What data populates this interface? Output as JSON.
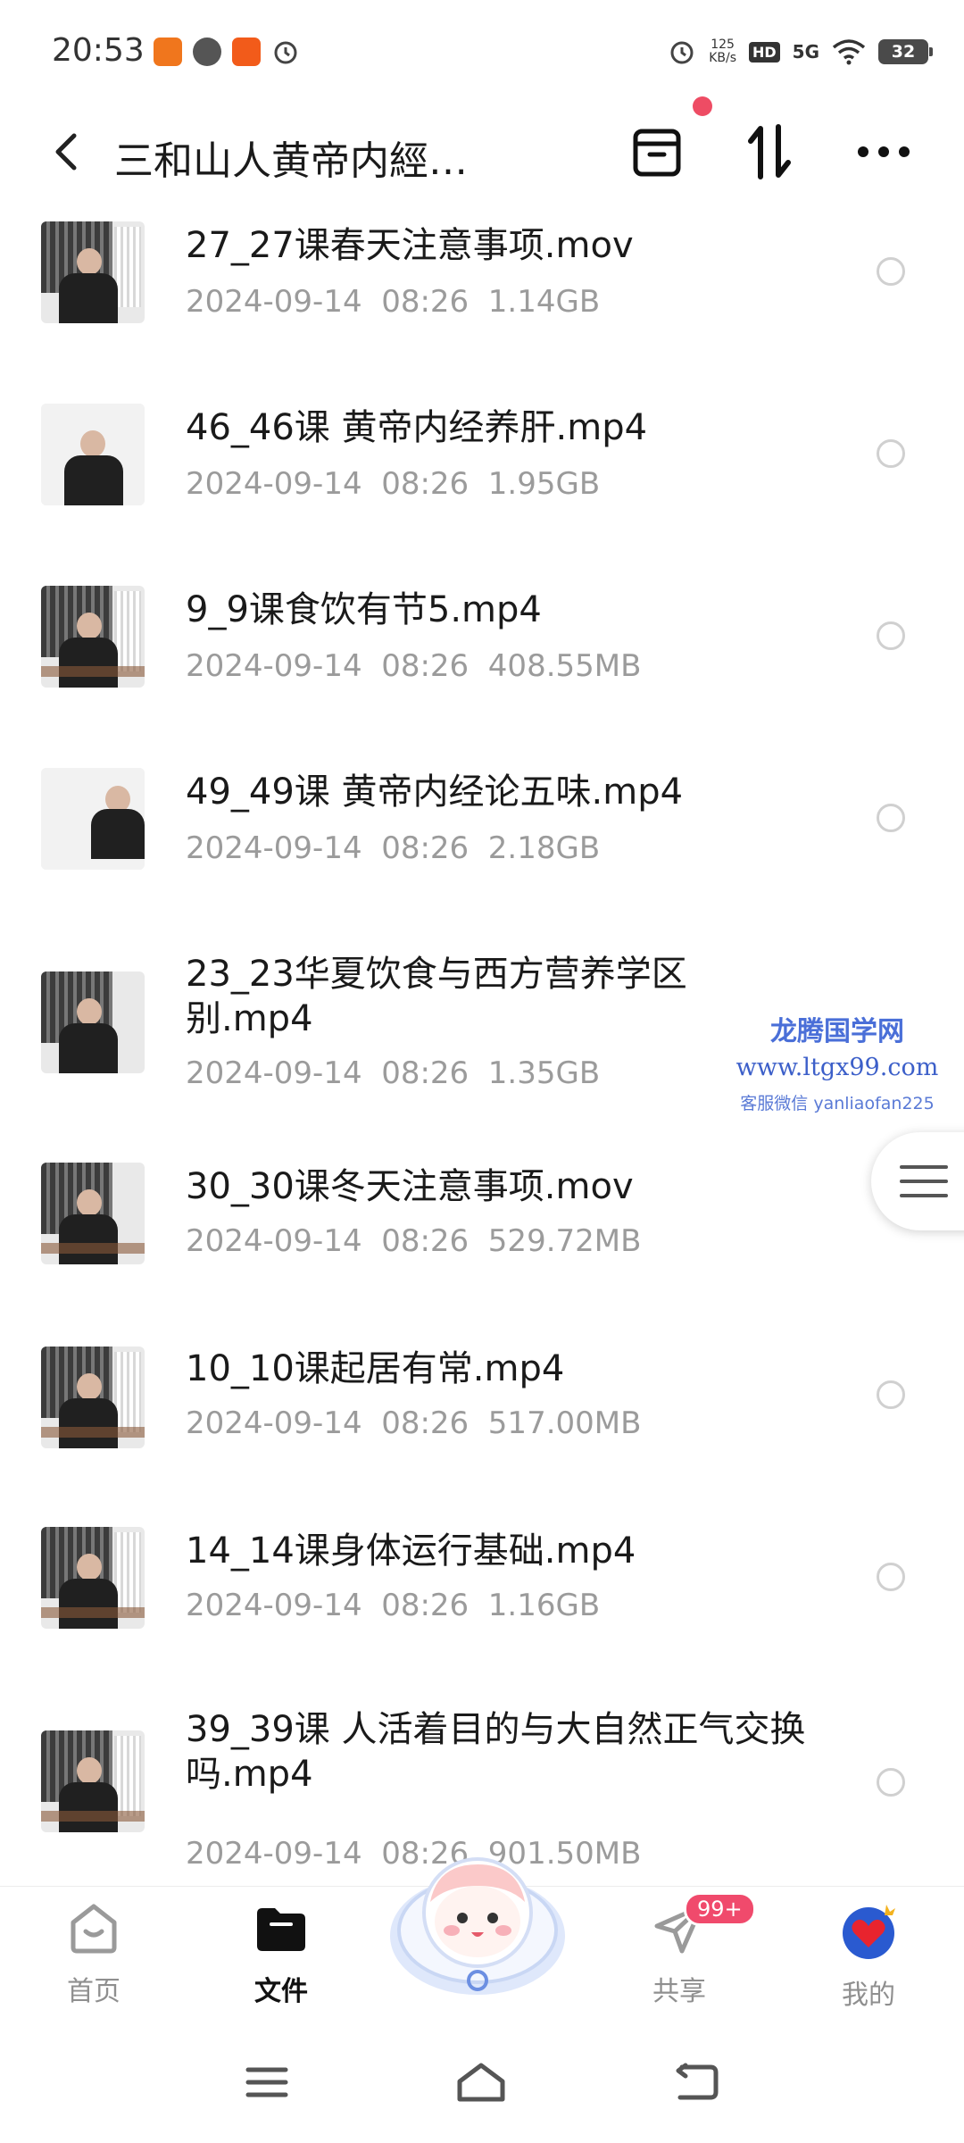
{
  "status_bar": {
    "time": "20:53",
    "net_speed_value": "125",
    "net_speed_unit": "KB/s",
    "hd": "HD",
    "network": "5G",
    "battery": "32"
  },
  "header": {
    "title": "三和山人黄帝内經…",
    "icons": [
      "back-icon",
      "trash-icon",
      "sort-icon",
      "more-icon"
    ]
  },
  "files": [
    {
      "name": "27_27课春天注意事项.mov",
      "meta": "2024-09-14  08:26  1.14GB"
    },
    {
      "name": "46_46课 黄帝内经养肝.mp4",
      "meta": "2024-09-14  08:26  1.95GB"
    },
    {
      "name": "9_9课食饮有节5.mp4",
      "meta": "2024-09-14  08:26  408.55MB"
    },
    {
      "name": "49_49课 黄帝内经论五味.mp4",
      "meta": "2024-09-14  08:26  2.18GB"
    },
    {
      "name": "23_23华夏饮食与西方营养学区别.mp4",
      "meta": "2024-09-14  08:26  1.35GB"
    },
    {
      "name": "30_30课冬天注意事项.mov",
      "meta": "2024-09-14  08:26  529.72MB"
    },
    {
      "name": "10_10课起居有常.mp4",
      "meta": "2024-09-14  08:26  517.00MB"
    },
    {
      "name": "14_14课身体运行基础.mp4",
      "meta": "2024-09-14  08:26  1.16GB"
    },
    {
      "name": "39_39课 人活着目的与大自然正气交换吗.mp4",
      "meta": "2024-09-14  08:26  901.50MB"
    }
  ],
  "watermark": {
    "title": "龙腾国学网",
    "url": "www.ltgx99.com",
    "contact": "客服微信 yanliaofan225"
  },
  "bottom_nav": {
    "home": "首页",
    "files": "文件",
    "share": "共享",
    "share_badge": "99+",
    "mine": "我的"
  },
  "colors": {
    "accent_red": "#ee4c64",
    "badge_red": "#f04a6c",
    "meta_gray": "#9b9b9b"
  }
}
